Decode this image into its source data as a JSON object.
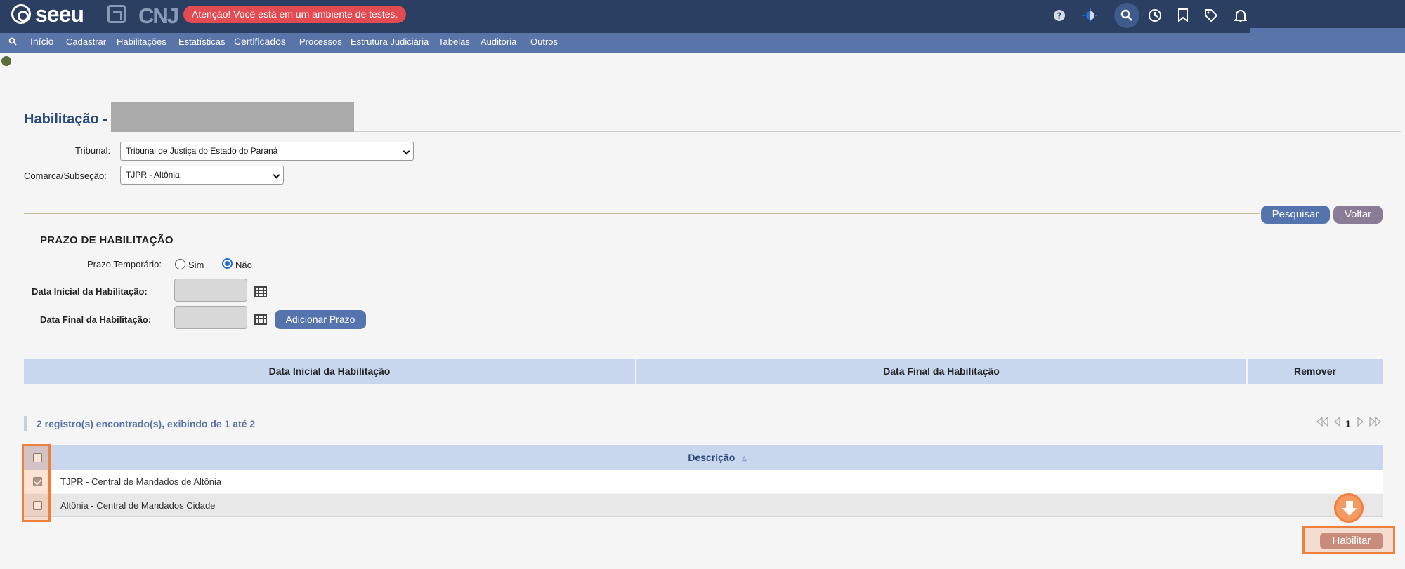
{
  "header": {
    "logo_text": "seeu",
    "cnj_text": "CNJ",
    "test_banner": "Atenção! Você está em um ambiente de testes.",
    "icons": [
      "help-icon",
      "theme-icon",
      "search-icon",
      "history-icon",
      "bookmark-icon",
      "tag-icon",
      "bell-icon"
    ]
  },
  "nav": {
    "items": [
      "Início",
      "Cadastrar",
      "Habilitações",
      "Estatísticas",
      "Certificados",
      "Processos",
      "Estrutura Judiciária",
      "Tabelas",
      "Auditoria",
      "Outros"
    ]
  },
  "page": {
    "title": "Habilitação -"
  },
  "form": {
    "tribunal_label": "Tribunal:",
    "tribunal_value": "Tribunal de Justiça do Estado do Paraná",
    "comarca_label": "Comarca/Subseção:",
    "comarca_value": "TJPR - Altônia",
    "pesquisar": "Pesquisar",
    "voltar": "Voltar"
  },
  "prazo": {
    "title": "PRAZO DE HABILITAÇÃO",
    "temporario_label": "Prazo Temporário:",
    "sim": "Sim",
    "nao": "Não",
    "selected": "Não",
    "data_inicial_label": "Data Inicial da Habilitação:",
    "data_final_label": "Data Final da Habilitação:",
    "adicionar": "Adicionar Prazo"
  },
  "prazo_table": {
    "headers": [
      "Data Inicial da Habilitação",
      "Data Final da Habilitação",
      "Remover"
    ]
  },
  "results": {
    "summary": "2 registro(s) encontrado(s), exibindo de 1 até 2",
    "current_page": "1",
    "column": "Descrição",
    "sort_arrow": "▵",
    "rows": [
      {
        "label": "TJPR - Central de Mandados de Altônia",
        "checked": true
      },
      {
        "label": "Altônia - Central de Mandados Cidade",
        "checked": false
      }
    ]
  },
  "actions": {
    "habilitar": "Habilitar"
  },
  "colors": {
    "header_bg": "#2b3f63",
    "nav_bg": "#5874a8",
    "banner": "#e24b52",
    "accent_orange": "#f07f3c"
  }
}
